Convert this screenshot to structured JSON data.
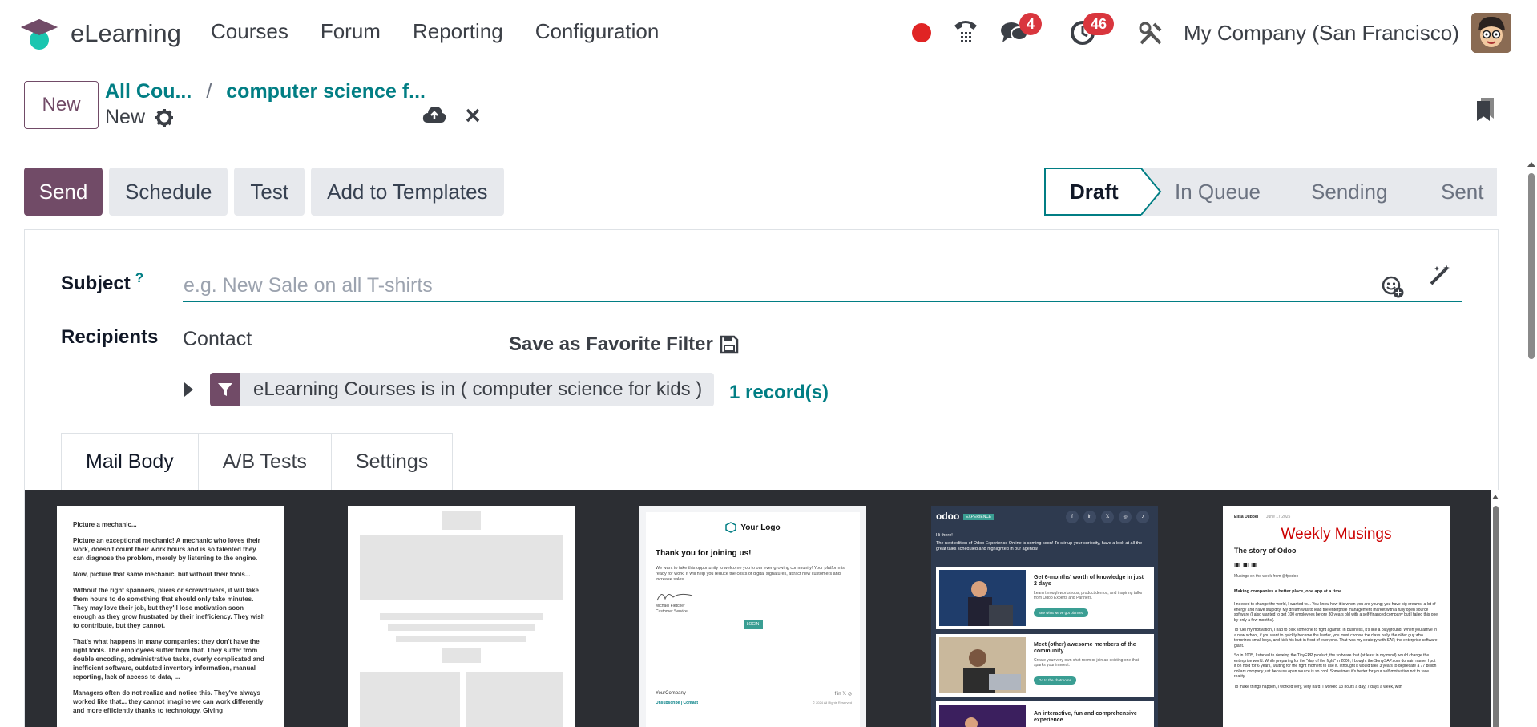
{
  "app": {
    "name": "eLearning",
    "menu": [
      "Courses",
      "Forum",
      "Reporting",
      "Configuration"
    ]
  },
  "systray": {
    "messages_count": "4",
    "activities_count": "46",
    "company": "My Company (San Francisco)"
  },
  "control": {
    "new_label": "New",
    "breadcrumb": [
      "All Cou...",
      "computer science f..."
    ],
    "breadcrumb_sep": "/",
    "current": "New"
  },
  "actions": {
    "send": "Send",
    "schedule": "Schedule",
    "test": "Test",
    "add_to_templates": "Add to Templates"
  },
  "status_stages": [
    "Draft",
    "In Queue",
    "Sending",
    "Sent"
  ],
  "active_stage": "Draft",
  "form": {
    "subject_label": "Subject",
    "subject_help": "?",
    "subject_placeholder": "e.g. New Sale on all T-shirts",
    "recipients_label": "Recipients",
    "recipients_value": "Contact",
    "save_favorite": "Save as Favorite Filter",
    "domain_text": "eLearning Courses is in ( computer science for kids )",
    "records": "1 record(s)"
  },
  "tabs": [
    "Mail Body",
    "A/B Tests",
    "Settings"
  ],
  "templates": {
    "t1": {
      "paragraphs": [
        "Picture a mechanic...",
        "Picture an exceptional mechanic! A mechanic who loves their work, doesn't count their work hours and is so talented they can diagnose the problem, merely by listening to the engine.",
        "Now, picture that same mechanic, but without their tools...",
        "Without the right spanners, pliers or screwdrivers, it will take them hours to do something that should only take minutes. They may love their job, but they'll lose motivation soon enough as they grow frustrated by their inefficiency. They wish to contribute, but they cannot.",
        "That's what happens in many companies: they don't have the right tools. The employees suffer from that. They suffer from double encoding, administrative tasks, overly complicated and inefficient software, outdated inventory information, manual reporting, lack of access to data, ...",
        "Managers often do not realize and notice this. They've always worked like that... they cannot imagine we can work differently and more efficiently thanks to technology. Giving"
      ]
    },
    "t3": {
      "logo": "Your Logo",
      "heading": "Thank you for joining us!",
      "body": "We want to take this opportunity to welcome you to our ever-growing community! Your platform is ready for work. It will help you reduce the costs of digital signatures, attract new customers and increase sales.",
      "signer": "Michael Fletcher",
      "signer_role": "Customer Service",
      "login": "LOGIN",
      "company": "YourCompany",
      "footer_links": "Unsubscribe | Contact",
      "rights": "© 2024 All Rights Reserved"
    },
    "t4": {
      "brand": "odoo",
      "tag": "EXPERIENCE",
      "hi": "Hi there!",
      "intro": "The next edition of Odoo Experience Online is coming soon! To stir up your curiosity, have a look at all the great talks scheduled and highlighted in our agenda!",
      "cards": [
        {
          "title": "Get 6-months' worth of knowledge in just 2 days",
          "text": "Learn through workshops, product demos, and inspiring talks from Odoo Experts and Partners.",
          "cta": "See what we've got planned"
        },
        {
          "title": "Meet (other) awesome members of the community",
          "text": "Create your very own chat room or join an existing one that sparks your interest.",
          "cta": "Go to the chatrooms"
        },
        {
          "title": "An interactive, fun and comprehensive experience",
          "text": "",
          "cta": ""
        }
      ]
    },
    "t5": {
      "author": "Elisa Dubbel",
      "date": "June 17 2025",
      "title": "Weekly Musings",
      "subtitle": "The story of Odoo",
      "byline": "Musings on the week from @fpodoo",
      "lead": "Making companies a better place, one app at a time",
      "p1": "I needed to change the world, I wanted to... You know how it is when you are young; you have big dreams, a lot of energy and naive stupidity. My dream was to lead the enterprise management market with a fully open source software (I also wanted to get 100 employees before 30 years old with a self-financed company but I failed this one by only a few months).",
      "p2": "To fuel my motivation, I had to pick someone to fight against. In business, it's like a playground. When you arrive in a new school, if you want to quickly become the leader, you must choose the class bully, the older guy who terrorizes small boys, and kick his butt in front of everyone. That was my strategy with SAP, the enterprise software giant.",
      "p3": "So in 2005, I started to develop the TinyERP product, the software that (at least in my mind) would change the enterprise world. While preparing for the \"day of the fight\" in 2006, I bought the SorrySAP.com domain name. I put it on hold for 6 years, waiting for the right moment to use it. I thought it would take 3 years to deprecate a 77 billion dollars company just because open source is so cool. Sometimes it's better for your self-motivation not to face reality...",
      "p4": "To make things happen, I worked very, very hard. I worked 13 hours a day, 7 days a week, with"
    }
  },
  "colors": {
    "primary": "#714b67",
    "teal": "#017e84",
    "badge": "#d9363e",
    "recording": "#e02424",
    "gallery_bg": "#2c2e33",
    "musings_title": "#cc0000"
  }
}
